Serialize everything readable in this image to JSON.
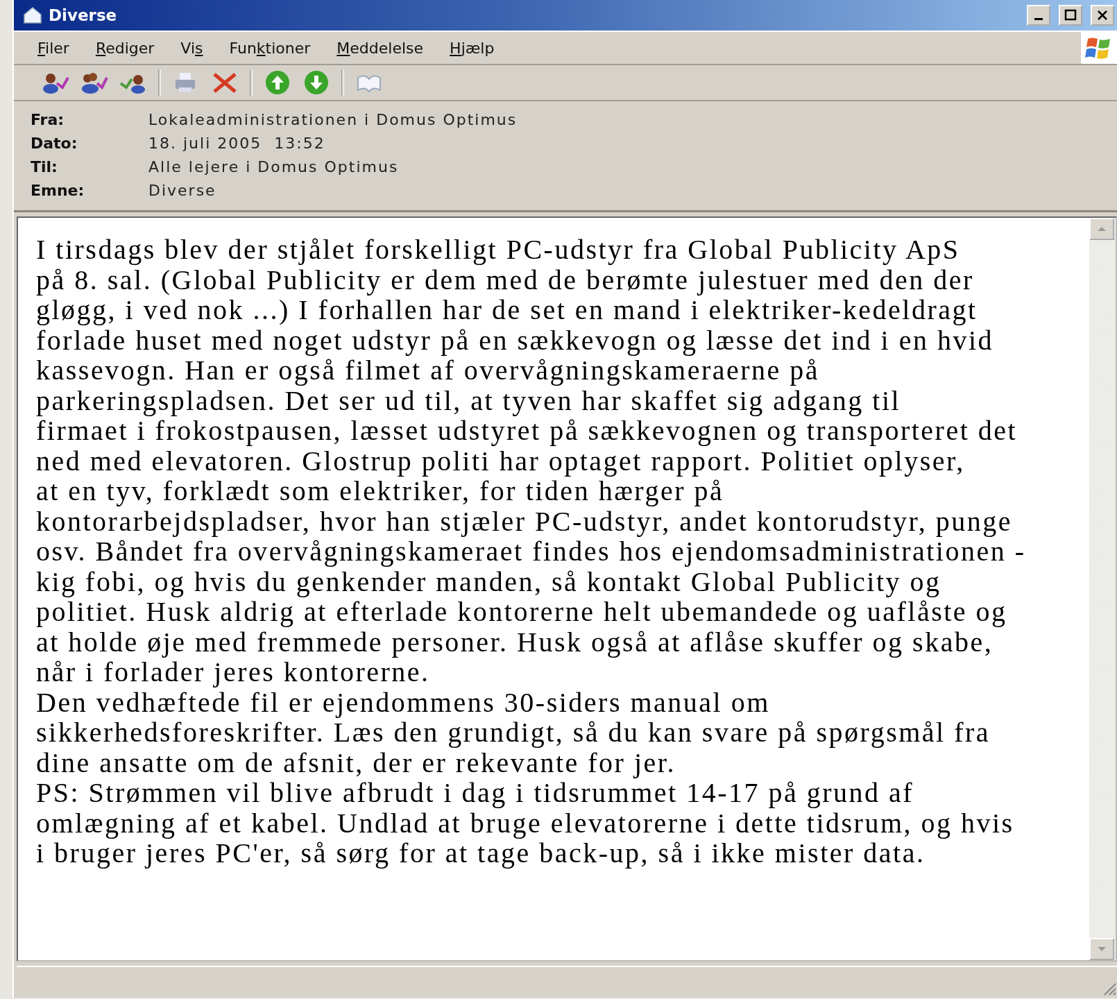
{
  "window": {
    "title": "Diverse"
  },
  "menu": [
    {
      "key": "F",
      "post": "iler"
    },
    {
      "key": "R",
      "post": "ediger"
    },
    {
      "pre": "Vi",
      "key": "s"
    },
    {
      "pre": "Fun",
      "key": "k",
      "post": "tioner"
    },
    {
      "key": "M",
      "post": "eddelelse"
    },
    {
      "key": "H",
      "post": "jælp"
    }
  ],
  "toolbar": [
    {
      "kind": "reply"
    },
    {
      "kind": "reply-all"
    },
    {
      "kind": "forward"
    },
    {
      "kind": "separator"
    },
    {
      "kind": "print"
    },
    {
      "kind": "delete"
    },
    {
      "kind": "separator"
    },
    {
      "kind": "previous"
    },
    {
      "kind": "next"
    },
    {
      "kind": "separator"
    },
    {
      "kind": "addresses"
    }
  ],
  "header": [
    {
      "label": "Fra:",
      "value": "Lokaleadministrationen i Domus Optimus"
    },
    {
      "label": "Dato:",
      "value": "18. juli 2005  13:52"
    },
    {
      "label": "Til:",
      "value": "Alle lejere i Domus Optimus"
    },
    {
      "label": "Emne:",
      "value": "Diverse"
    }
  ],
  "body": [
    [
      "I tirsdags blev der stjålet forskelligt PC-udstyr fra Global Publicity ApS",
      "på 8. sal. (Global Publicity er dem med de berømte julestuer med den der",
      "gløgg, i ved nok ...) I forhallen har de set en mand i elektriker-kedeldragt",
      "forlade huset med noget udstyr på en sækkevogn og læsse det ind i en hvid",
      "kassevogn. Han er også filmet af overvågningskameraerne på",
      "parkeringspladsen. Det ser ud til, at tyven har skaffet sig adgang til",
      "firmaet i frokostpausen, læsset udstyret på sækkevognen og transporteret det",
      "ned med elevatoren. Glostrup politi har optaget rapport. Politiet oplyser,",
      "at en tyv, forklædt som elektriker, for tiden hærger på",
      "kontorarbejdspladser, hvor han stjæler PC-udstyr, andet kontorudstyr, punge",
      "osv. Båndet fra overvågningskameraet findes hos ejendomsadministrationen -",
      "kig fobi, og hvis du genkender manden, så kontakt Global Publicity og",
      "politiet. Husk aldrig at efterlade kontorerne helt ubemandede og uaflåste og",
      "at holde øje med fremmede personer. Husk også at aflåse skuffer og skabe,",
      "når i forlader jeres kontorerne."
    ],
    [
      "Den vedhæftede fil er ejendommens 30-siders manual om",
      "sikkerhedsforeskrifter. Læs den grundigt, så du kan svare på spørgsmål fra",
      "dine ansatte om de afsnit, der er rekevante for jer."
    ],
    [
      "PS: Strømmen vil blive afbrudt i dag i tidsrummet 14-17 på grund af",
      "omlægning af et kabel. Undlad at bruge elevatorerne i dette tidsrum, og hvis",
      "i bruger jeres PC'er, så sørg for at tage back-up, så i ikke mister data."
    ]
  ]
}
